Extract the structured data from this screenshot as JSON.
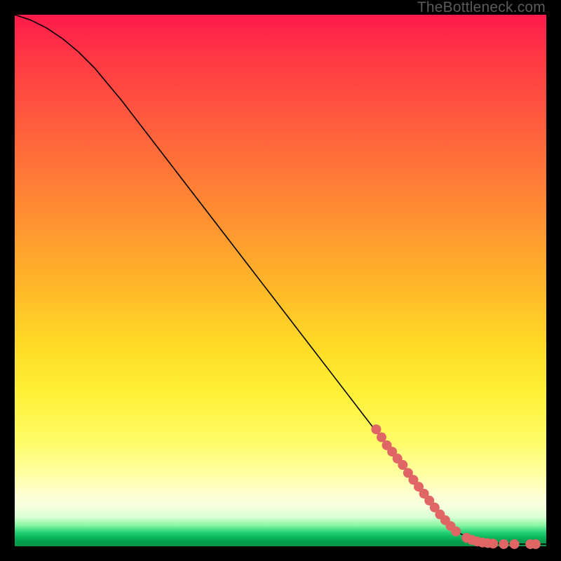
{
  "watermark": "TheBottleneck.com",
  "colors": {
    "dot": "#e06666",
    "curve": "#000000"
  },
  "chart_data": {
    "type": "line",
    "title": "",
    "xlabel": "",
    "ylabel": "",
    "xlim": [
      0,
      100
    ],
    "ylim": [
      0,
      100
    ],
    "series": [
      {
        "name": "curve",
        "x": [
          0,
          3,
          6,
          9,
          12,
          15,
          20,
          30,
          40,
          50,
          60,
          70,
          75,
          80,
          83,
          86,
          90,
          95,
          100
        ],
        "y": [
          100,
          99,
          97.5,
          95.5,
          93,
          90,
          84,
          71,
          58,
          45,
          32,
          19,
          12.5,
          6,
          2.8,
          1.3,
          0.6,
          0.4,
          0.4
        ]
      }
    ],
    "scatter": [
      {
        "name": "highlighted-points",
        "points": [
          {
            "x": 68,
            "y": 22.0
          },
          {
            "x": 69,
            "y": 20.5
          },
          {
            "x": 70,
            "y": 19.0
          },
          {
            "x": 71,
            "y": 17.8
          },
          {
            "x": 72,
            "y": 16.5
          },
          {
            "x": 73,
            "y": 15.3
          },
          {
            "x": 74,
            "y": 13.8
          },
          {
            "x": 75,
            "y": 12.5
          },
          {
            "x": 76,
            "y": 11.2
          },
          {
            "x": 77,
            "y": 9.9
          },
          {
            "x": 78,
            "y": 8.6
          },
          {
            "x": 79,
            "y": 7.3
          },
          {
            "x": 80,
            "y": 6.0
          },
          {
            "x": 81,
            "y": 4.9
          },
          {
            "x": 82,
            "y": 3.8
          },
          {
            "x": 83,
            "y": 2.8
          },
          {
            "x": 85,
            "y": 1.6
          },
          {
            "x": 86,
            "y": 1.2
          },
          {
            "x": 87,
            "y": 0.9
          },
          {
            "x": 88,
            "y": 0.7
          },
          {
            "x": 89,
            "y": 0.6
          },
          {
            "x": 90,
            "y": 0.5
          },
          {
            "x": 92,
            "y": 0.4
          },
          {
            "x": 94,
            "y": 0.4
          },
          {
            "x": 97,
            "y": 0.4
          },
          {
            "x": 98,
            "y": 0.4
          }
        ]
      }
    ]
  }
}
